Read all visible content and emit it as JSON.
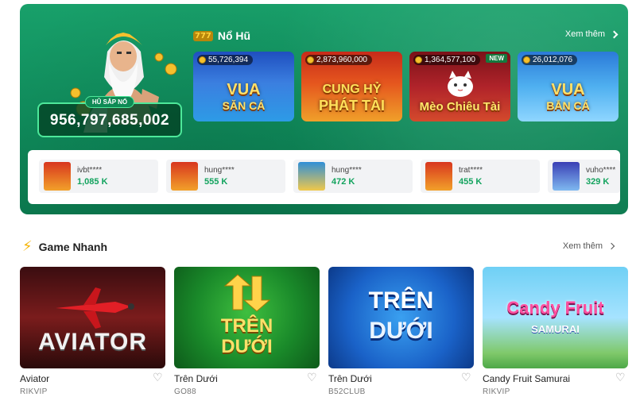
{
  "no_hu": {
    "title": "Nổ Hũ",
    "slot_icon": "777",
    "see_more": "Xem thêm",
    "jackpot_label": "HŨ SẮP NỔ",
    "jackpot_value": "956,797,685,002",
    "games": [
      {
        "jackpot": "55,726,394",
        "title_line1": "VUA",
        "title_line2": "SĂN CÁ"
      },
      {
        "jackpot": "2,873,960,000",
        "title_line1": "CUNG HỶ",
        "title_line2": "PHÁT TÀI"
      },
      {
        "jackpot": "1,364,577,100",
        "title_line1": "Mèo Chiêu Tài",
        "title_line2": "",
        "badge": "NEW"
      },
      {
        "jackpot": "26,012,076",
        "title_line1": "VUA",
        "title_line2": "BẮN CÁ"
      }
    ],
    "winners": [
      {
        "user": "ivbt****",
        "amount": "1,085 K"
      },
      {
        "user": "hung****",
        "amount": "555 K"
      },
      {
        "user": "hung****",
        "amount": "472 K"
      },
      {
        "user": "trat****",
        "amount": "455 K"
      },
      {
        "user": "vuho****",
        "amount": "329 K"
      }
    ]
  },
  "game_nhanh": {
    "title": "Game Nhanh",
    "see_more": "Xem thêm",
    "games": [
      {
        "art": "AVIATOR",
        "name": "Aviator",
        "provider": "RIKVIP"
      },
      {
        "art_line1": "TRÊN",
        "art_line2": "DƯỚI",
        "name": "Trên Dưới",
        "provider": "GO88"
      },
      {
        "art_line1": "TRÊN",
        "art_line2": "DƯỚI",
        "name": "Trên Dưới",
        "provider": "B52CLUB"
      },
      {
        "art_line1": "Candy Fruit",
        "art_line2": "SAMURAI",
        "name": "Candy Fruit Samurai",
        "provider": "RIKVIP"
      }
    ]
  },
  "colors": {
    "brand_green": "#0f8b5b",
    "win_green": "#13a35e",
    "gold": "#f5b50a"
  },
  "icons": {
    "heart": "heart-icon",
    "bolt": "lightning-icon",
    "chevron": "chevron-right-icon",
    "coin": "coin-icon"
  }
}
